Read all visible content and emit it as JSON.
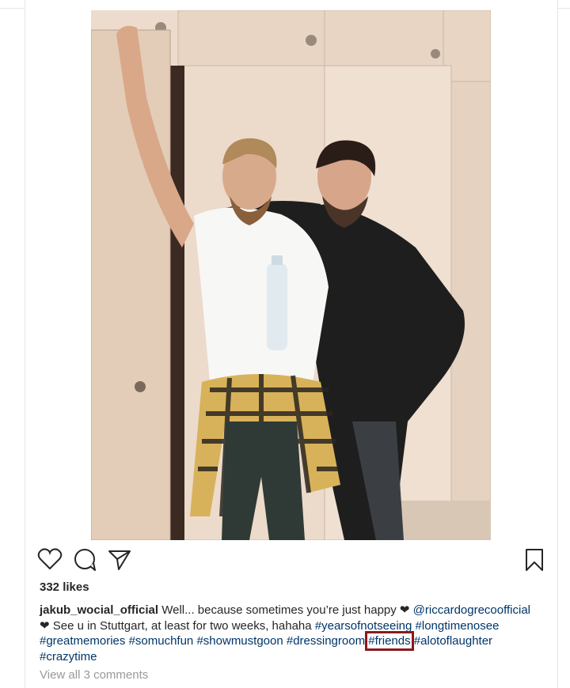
{
  "post": {
    "image_alt": "Two men smiling in front of lockers",
    "likes": "332 likes",
    "username": "jakub_wocial_official",
    "caption_text_1": "Well... because sometimes you’re just happy ❤",
    "mention": "@riccardogrecoofficial",
    "caption_text_2": "❤ See u in Stuttgart, at least for two weeks, hahaha",
    "tags": [
      "#yearsofnotseeing",
      "#longtimenosee",
      "#greatmemories",
      "#somuchfun",
      "#showmustgoon",
      "#dressingroom",
      "#friends",
      "#alotoflaughter",
      "#crazytime"
    ],
    "view_comments": "View all 3 comments"
  },
  "actions": {
    "like_icon": "heart-icon",
    "comment_icon": "speech-bubble-icon",
    "share_icon": "paper-plane-icon",
    "save_icon": "bookmark-icon"
  },
  "colors": {
    "link": "#003569",
    "highlight_box": "#8b1a1a",
    "muted": "#999999"
  }
}
